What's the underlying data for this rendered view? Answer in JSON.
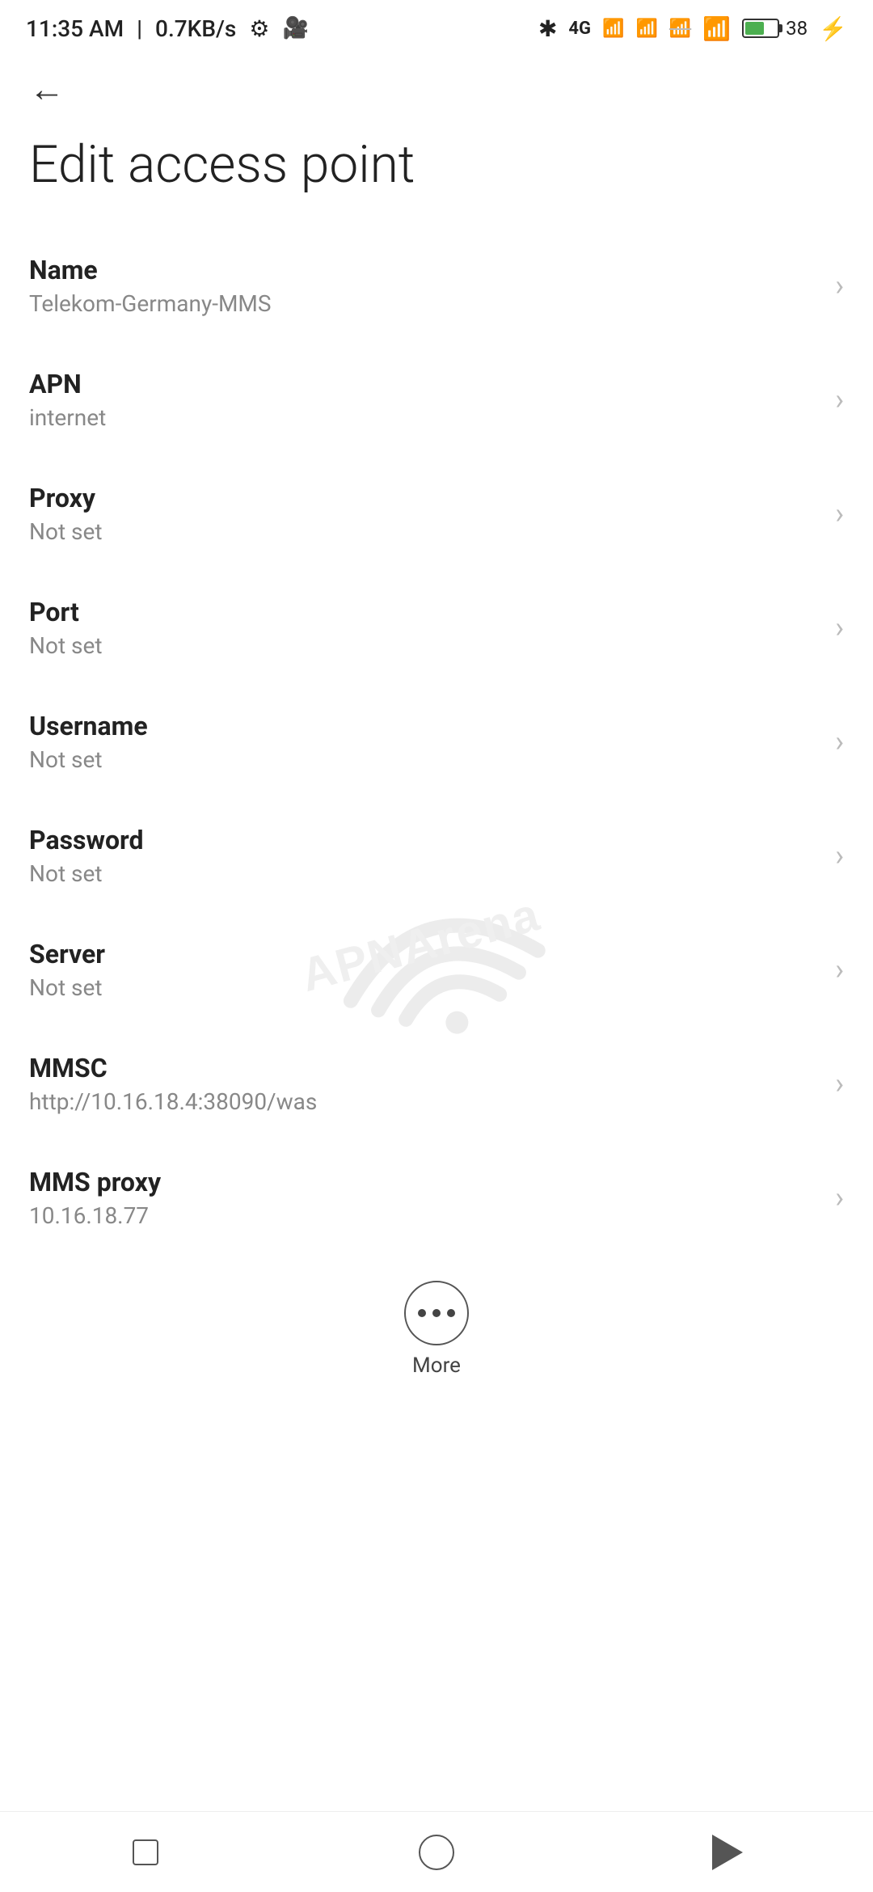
{
  "statusBar": {
    "time": "11:35 AM",
    "network": "0.7KB/s",
    "battery": "38"
  },
  "toolbar": {
    "backLabel": "←"
  },
  "page": {
    "title": "Edit access point"
  },
  "settings": [
    {
      "label": "Name",
      "value": "Telekom-Germany-MMS"
    },
    {
      "label": "APN",
      "value": "internet"
    },
    {
      "label": "Proxy",
      "value": "Not set"
    },
    {
      "label": "Port",
      "value": "Not set"
    },
    {
      "label": "Username",
      "value": "Not set"
    },
    {
      "label": "Password",
      "value": "Not set"
    },
    {
      "label": "Server",
      "value": "Not set"
    },
    {
      "label": "MMSC",
      "value": "http://10.16.18.4:38090/was"
    },
    {
      "label": "MMS proxy",
      "value": "10.16.18.77"
    }
  ],
  "more": {
    "label": "More"
  },
  "watermark": {
    "text": "APNArena"
  },
  "nav": {
    "square": "square-home-button",
    "circle": "circle-home-button",
    "triangle": "back-triangle-button"
  }
}
